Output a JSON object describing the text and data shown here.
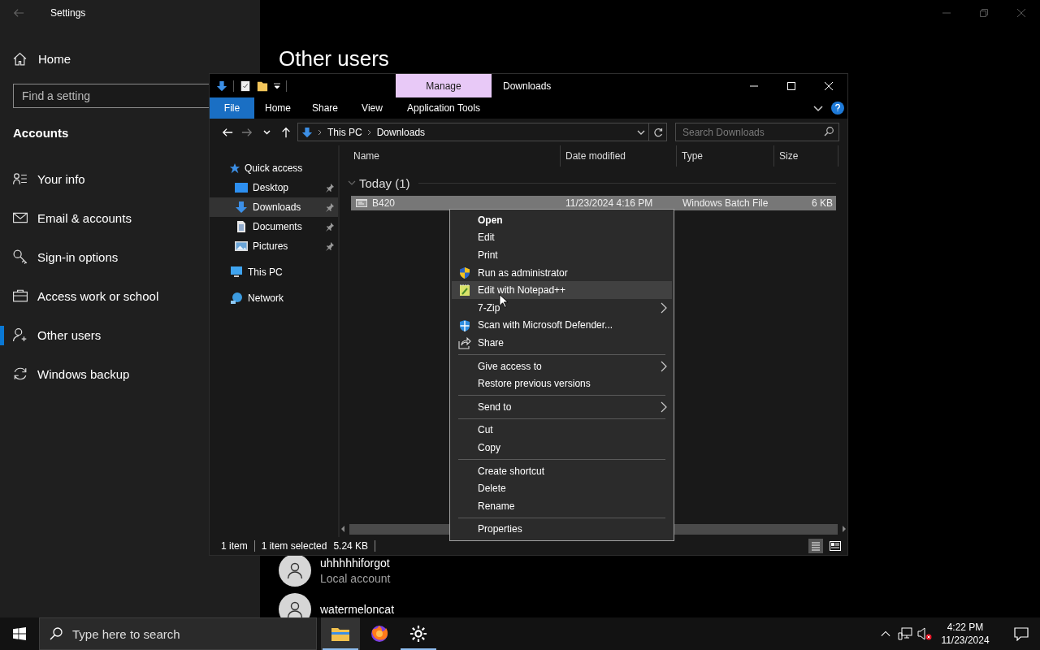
{
  "settings": {
    "title": "Settings",
    "home": "Home",
    "search": {
      "placeholder": "Find a setting"
    },
    "section": "Accounts",
    "nav": [
      {
        "label": "Your info",
        "selected": false
      },
      {
        "label": "Email & accounts",
        "selected": false
      },
      {
        "label": "Sign-in options",
        "selected": false
      },
      {
        "label": "Access work or school",
        "selected": false
      },
      {
        "label": "Other users",
        "selected": true
      },
      {
        "label": "Windows backup",
        "selected": false
      }
    ],
    "page_title": "Other users",
    "users": [
      {
        "name": "uhhhhhiforgot",
        "subtitle": "Local account"
      },
      {
        "name": "watermeloncat"
      }
    ]
  },
  "explorer": {
    "context_tab": "Manage",
    "title": "Downloads",
    "ribbon_tabs": [
      {
        "label": "File",
        "kind": "file"
      },
      {
        "label": "Home",
        "kind": "tab"
      },
      {
        "label": "Share",
        "kind": "tab"
      },
      {
        "label": "View",
        "kind": "tab"
      },
      {
        "label": "Application Tools",
        "kind": "tab"
      }
    ],
    "address": [
      "This PC",
      "Downloads"
    ],
    "search": {
      "placeholder": "Search Downloads"
    },
    "nav_pane": [
      {
        "label": "Quick access",
        "selected": false,
        "children": [
          {
            "label": "Desktop",
            "selected": false,
            "pinned": true
          },
          {
            "label": "Downloads",
            "selected": true,
            "pinned": true
          },
          {
            "label": "Documents",
            "selected": false,
            "pinned": true
          },
          {
            "label": "Pictures",
            "selected": false,
            "pinned": true
          }
        ]
      },
      {
        "label": "This PC",
        "selected": false
      },
      {
        "label": "Network",
        "selected": false
      }
    ],
    "columns": [
      "Name",
      "Date modified",
      "Type",
      "Size"
    ],
    "groups": [
      {
        "label": "Today (1)",
        "expanded": true,
        "rows": [
          {
            "selected": true,
            "cells": [
              "B420",
              "11/23/2024 4:16 PM",
              "Windows Batch File",
              "6 KB"
            ]
          }
        ]
      }
    ],
    "status_bar": {
      "count": "1 item",
      "selection": "1 item selected",
      "size": "5.24 KB"
    }
  },
  "context_menu": {
    "sections": [
      {
        "items": [
          {
            "label": "Open",
            "default": true,
            "highlighted": false,
            "submenu": false
          },
          {
            "label": "Edit",
            "default": false,
            "highlighted": false,
            "submenu": false
          },
          {
            "label": "Print",
            "default": false,
            "highlighted": false,
            "submenu": false
          },
          {
            "label": "Run as administrator",
            "default": false,
            "highlighted": false,
            "submenu": false
          },
          {
            "label": "Edit with Notepad++",
            "default": false,
            "highlighted": true,
            "submenu": false
          },
          {
            "label": "7-Zip",
            "default": false,
            "highlighted": false,
            "submenu": true
          },
          {
            "label": "Scan with Microsoft Defender...",
            "default": false,
            "highlighted": false,
            "submenu": false
          },
          {
            "label": "Share",
            "default": false,
            "highlighted": false,
            "submenu": false
          }
        ]
      },
      {
        "items": [
          {
            "label": "Give access to",
            "default": false,
            "highlighted": false,
            "submenu": true
          },
          {
            "label": "Restore previous versions",
            "default": false,
            "highlighted": false,
            "submenu": false
          }
        ]
      },
      {
        "items": [
          {
            "label": "Send to",
            "default": false,
            "highlighted": false,
            "submenu": true
          }
        ]
      },
      {
        "items": [
          {
            "label": "Cut",
            "default": false,
            "highlighted": false,
            "submenu": false
          },
          {
            "label": "Copy",
            "default": false,
            "highlighted": false,
            "submenu": false
          }
        ]
      },
      {
        "items": [
          {
            "label": "Create shortcut",
            "default": false,
            "highlighted": false,
            "submenu": false
          },
          {
            "label": "Delete",
            "default": false,
            "highlighted": false,
            "submenu": false
          },
          {
            "label": "Rename",
            "default": false,
            "highlighted": false,
            "submenu": false
          }
        ]
      },
      {
        "items": [
          {
            "label": "Properties",
            "default": false,
            "highlighted": false,
            "submenu": false
          }
        ]
      }
    ]
  },
  "taskbar": {
    "search": {
      "placeholder": "Type here to search"
    },
    "apps": [
      {
        "active": true,
        "running": true
      },
      {
        "active": false,
        "running": false
      },
      {
        "active": false,
        "running": true
      }
    ],
    "time": "4:22 PM",
    "date": "11/23/2024"
  }
}
